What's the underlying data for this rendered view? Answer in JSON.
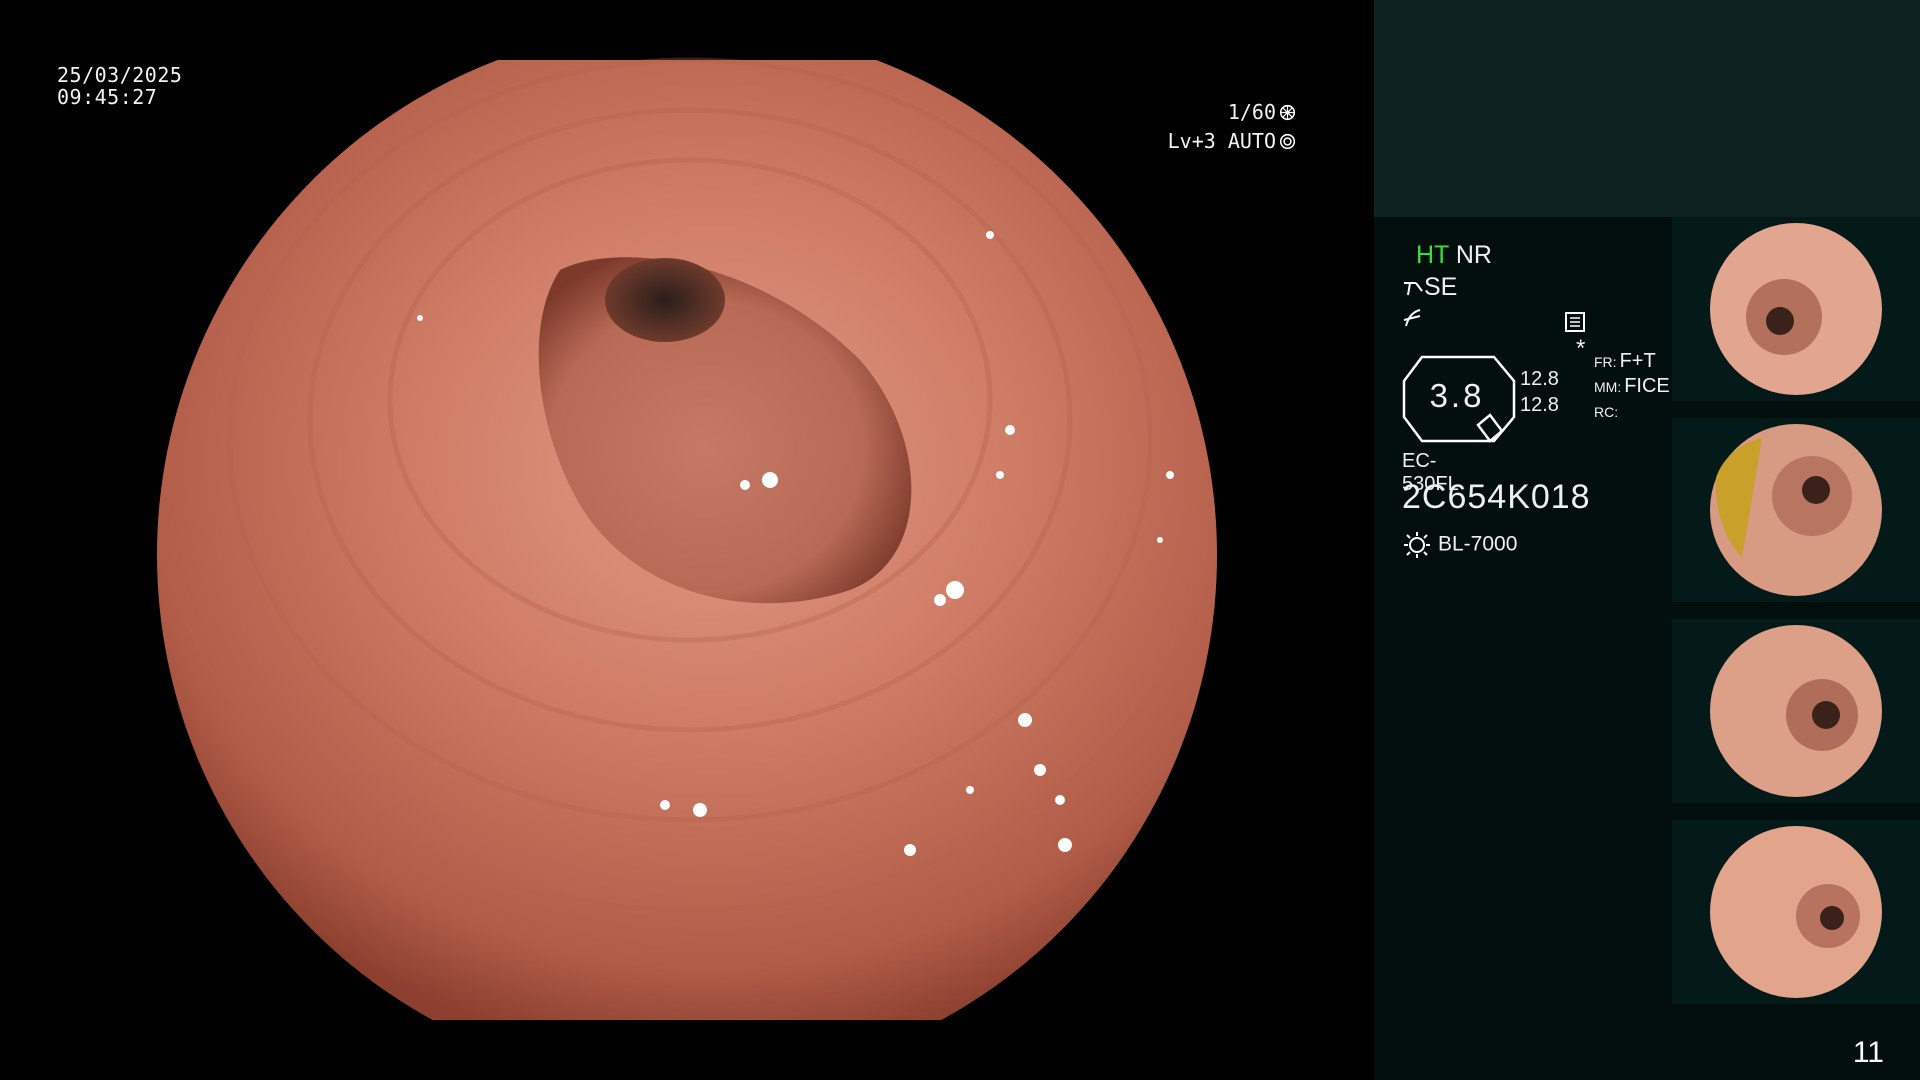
{
  "overlay": {
    "date": "25/03/2025",
    "time": "09:45:27",
    "shutter": "1/60",
    "exposure": "Lv+3 AUTO"
  },
  "panel": {
    "ht_label": "HT",
    "nr_label": "NR",
    "se_label": "SE",
    "asterisk": "*",
    "gauge_value": "3.8",
    "stat_1": "12.8",
    "stat_2": "12.8",
    "fr_label": "FR:",
    "fr_value": "F+T",
    "mm_label": "MM:",
    "mm_value": "FICE",
    "rc_label": "RC:",
    "scope_model": "EC-530FL",
    "serial": "2C654K018",
    "light_source": "BL-7000"
  },
  "page_number": "11",
  "colors": {
    "panel_bg": "#020f0d",
    "panel_top_bg": "#0f2222",
    "ht_green": "#38e038",
    "mucosa": "#c8735f"
  }
}
